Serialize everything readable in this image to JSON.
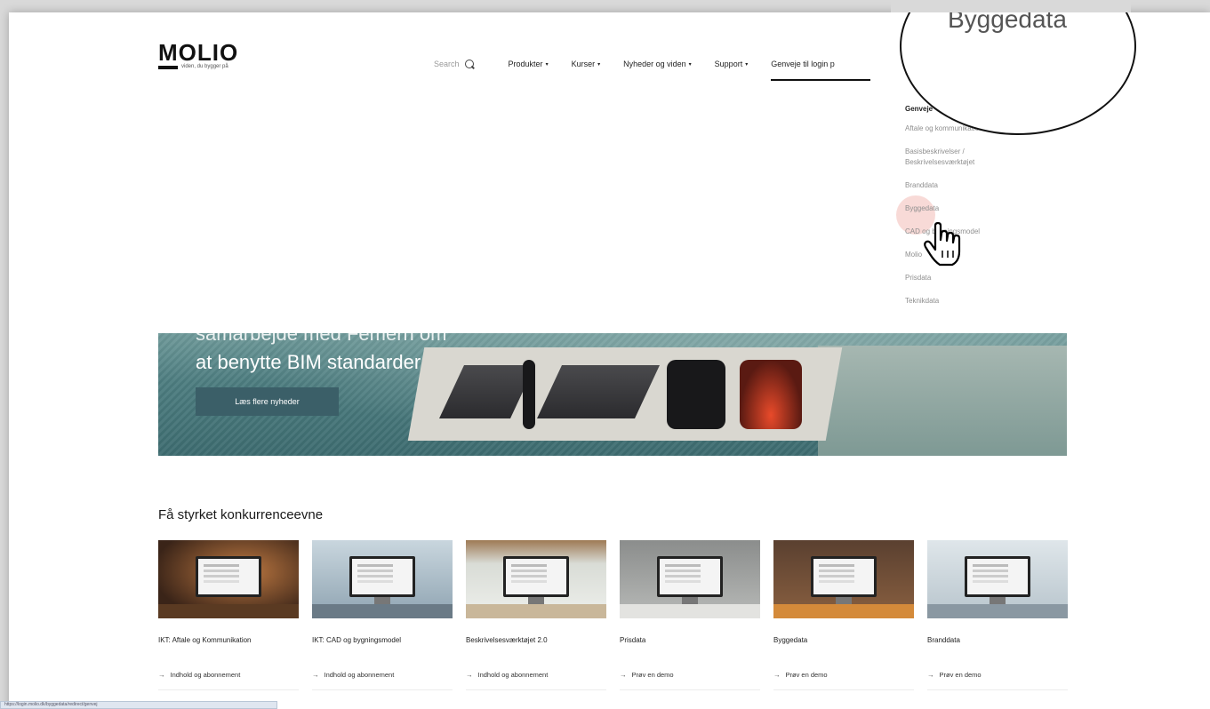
{
  "brand": {
    "logo": "MOLIO",
    "tagline": "viden, du bygger på"
  },
  "header": {
    "search_label": "Search",
    "nav": [
      {
        "label": "Produkter",
        "caret": "▾"
      },
      {
        "label": "Kurser",
        "caret": "▾"
      },
      {
        "label": "Nyheder og viden",
        "caret": "▾"
      },
      {
        "label": "Support",
        "caret": "▾"
      }
    ],
    "active_nav": "Genveje til login p"
  },
  "dropdown": {
    "heading": "Genveje",
    "items": [
      "Aftale og kommunikation",
      "Basisbeskrivelser / Beskrivelsesværktøjet",
      "Branddata",
      "Byggedata",
      "CAD og bygningsmodel",
      "Molio",
      "Prisdata",
      "Teknikdata"
    ]
  },
  "magnifier": {
    "text": "Byggedata"
  },
  "hero": {
    "title_cut": "samarbejde med Femern om",
    "title": "at benytte BIM standarder",
    "button": "Læs flere nyheder"
  },
  "products": {
    "section_title": "Få styrket konkurrenceevne",
    "cards": [
      {
        "title": "IKT: Aftale og Kommunikation",
        "link": "Indhold og abonnement",
        "arrow": "→",
        "scene": "warm"
      },
      {
        "title": "IKT: CAD og bygningsmodel",
        "link": "Indhold og abonnement",
        "arrow": "→",
        "scene": "office"
      },
      {
        "title": "Beskrivelsesværktøjet 2.0",
        "link": "Indhold og abonnement",
        "arrow": "→",
        "scene": "plants"
      },
      {
        "title": "Prisdata",
        "link": "Prøv en demo",
        "arrow": "→",
        "scene": "concrete"
      },
      {
        "title": "Byggedata",
        "link": "Prøv en demo",
        "arrow": "→",
        "scene": "wood"
      },
      {
        "title": "Branddata",
        "link": "Prøv en demo",
        "arrow": "→",
        "scene": "bright"
      }
    ]
  },
  "status_bar": {
    "text": "https://login.molio.dk/byggedata/redirect/genvej"
  },
  "colors": {
    "hero_button": "#3b5f68",
    "accent_highlight": "#eb968c"
  }
}
